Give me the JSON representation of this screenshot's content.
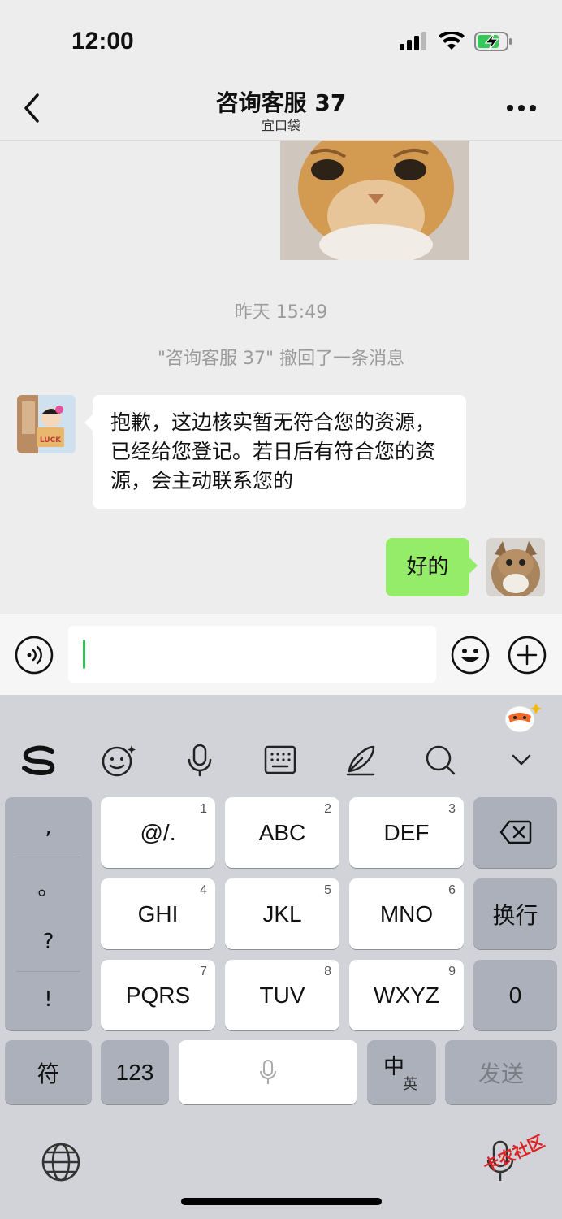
{
  "status_bar": {
    "time": "12:00"
  },
  "header": {
    "title": "咨询客服 37",
    "subtitle": "宜口袋"
  },
  "chat": {
    "timestamp": "昨天 15:49",
    "recall_notice": "\"咨询客服 37\" 撤回了一条消息",
    "incoming_message": "抱歉，这边核实暂无符合您的资源，已经给您登记。若日后有符合您的资源，会主动联系您的",
    "outgoing_message": "好的",
    "avatar_badge": "LUCK"
  },
  "input": {
    "value": ""
  },
  "keyboard": {
    "punctuation": [
      ",",
      "。",
      "?",
      "!"
    ],
    "keys": [
      {
        "label": "@/.",
        "num": "1"
      },
      {
        "label": "ABC",
        "num": "2"
      },
      {
        "label": "DEF",
        "num": "3"
      },
      {
        "label": "GHI",
        "num": "4"
      },
      {
        "label": "JKL",
        "num": "5"
      },
      {
        "label": "MNO",
        "num": "6"
      },
      {
        "label": "PQRS",
        "num": "7"
      },
      {
        "label": "TUV",
        "num": "8"
      },
      {
        "label": "WXYZ",
        "num": "9"
      }
    ],
    "newline": "换行",
    "zero": "0",
    "symbol": "符",
    "numbers": "123",
    "lang_main": "中",
    "lang_alt": "英",
    "send": "发送"
  },
  "watermark": "卡农社区",
  "colors": {
    "outgoing_bubble": "#95ec69",
    "caret": "#2dc15a",
    "background": "#ededed"
  }
}
